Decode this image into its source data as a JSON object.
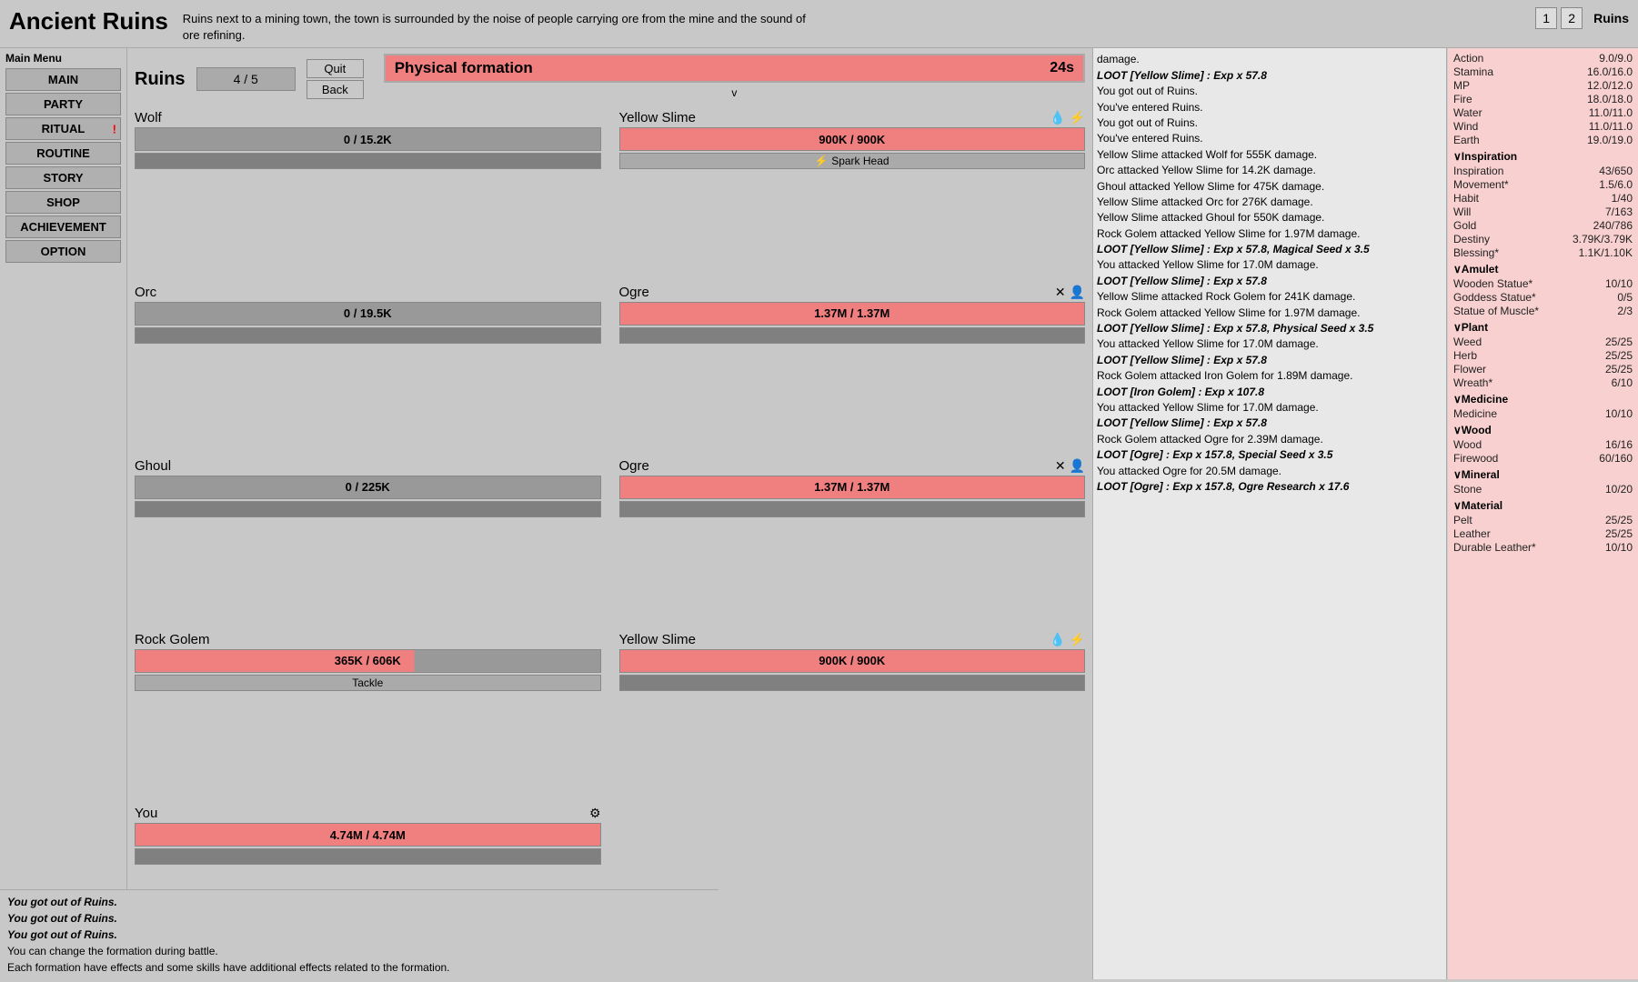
{
  "header": {
    "title": "Ancient Ruins",
    "description": "Ruins next to a mining town, the town is surrounded by the noise of people carrying ore from the mine and the sound of ore refining.",
    "page_nums": [
      "1",
      "2"
    ],
    "ruins_label": "Ruins"
  },
  "sidebar": {
    "menu_label": "Main Menu",
    "buttons": [
      {
        "label": "MAIN",
        "badge": ""
      },
      {
        "label": "PARTY",
        "badge": ""
      },
      {
        "label": "RITUAL",
        "badge": "!"
      },
      {
        "label": "ROUTINE",
        "badge": ""
      },
      {
        "label": "STORY",
        "badge": ""
      },
      {
        "label": "SHOP",
        "badge": ""
      },
      {
        "label": "ACHIEVEMENT",
        "badge": ""
      },
      {
        "label": "OPTION",
        "badge": ""
      }
    ]
  },
  "battle": {
    "title": "Ruins",
    "progress": "4 / 5",
    "quit_btn": "Quit",
    "back_btn": "Back",
    "formation": {
      "name": "Physical formation",
      "time": "24s",
      "arrow": "v"
    },
    "left_units": [
      {
        "name": "Wolf",
        "hp": "0 / 15.2K",
        "hp_color": "gray",
        "sub": "",
        "icons": []
      },
      {
        "name": "Orc",
        "hp": "0 / 19.5K",
        "hp_color": "gray",
        "sub": "",
        "icons": []
      },
      {
        "name": "Ghoul",
        "hp": "0 / 225K",
        "hp_color": "gray",
        "sub": "",
        "icons": []
      },
      {
        "name": "Rock Golem",
        "hp": "365K / 606K",
        "hp_color": "red",
        "sub": "Tackle",
        "icons": []
      },
      {
        "name": "You",
        "hp": "4.74M / 4.74M",
        "hp_color": "red",
        "sub": "",
        "icons": [
          "⚙"
        ]
      }
    ],
    "right_units": [
      {
        "name": "Yellow Slime",
        "hp": "900K / 900K",
        "hp_color": "red",
        "sub": "⚡ Spark Head",
        "icons": [
          "💧",
          "⚡"
        ]
      },
      {
        "name": "Ogre",
        "hp": "1.37M / 1.37M",
        "hp_color": "red",
        "sub": "",
        "icons": [
          "✕",
          "👤"
        ]
      },
      {
        "name": "Ogre",
        "hp": "1.37M / 1.37M",
        "hp_color": "red",
        "sub": "",
        "icons": [
          "✕",
          "👤"
        ]
      },
      {
        "name": "Yellow Slime",
        "hp": "900K / 900K",
        "hp_color": "red",
        "sub": "",
        "icons": [
          "💧",
          "⚡"
        ]
      }
    ]
  },
  "log": [
    {
      "text": "damage.",
      "bold": false
    },
    {
      "text": "LOOT [Yellow Slime] : Exp x 57.8",
      "bold": true
    },
    {
      "text": "You got out of Ruins.",
      "bold": false
    },
    {
      "text": "You've entered Ruins.",
      "bold": false
    },
    {
      "text": "You got out of Ruins.",
      "bold": false
    },
    {
      "text": "You've entered Ruins.",
      "bold": false
    },
    {
      "text": "Yellow Slime attacked Wolf for 555K damage.",
      "bold": false
    },
    {
      "text": "Orc attacked Yellow Slime for 14.2K damage.",
      "bold": false
    },
    {
      "text": "Ghoul attacked Yellow Slime for 475K damage.",
      "bold": false
    },
    {
      "text": "Yellow Slime attacked Orc for 276K damage.",
      "bold": false
    },
    {
      "text": "Yellow Slime attacked Ghoul for 550K damage.",
      "bold": false
    },
    {
      "text": "Rock Golem attacked Yellow Slime for 1.97M damage.",
      "bold": false
    },
    {
      "text": "LOOT [Yellow Slime] : Exp x 57.8, Magical Seed x 3.5",
      "bold": true
    },
    {
      "text": "You attacked Yellow Slime for 17.0M damage.",
      "bold": false
    },
    {
      "text": "LOOT [Yellow Slime] : Exp x 57.8",
      "bold": true
    },
    {
      "text": "Yellow Slime attacked Rock Golem for 241K damage.",
      "bold": false
    },
    {
      "text": "Rock Golem attacked Yellow Slime for 1.97M damage.",
      "bold": false
    },
    {
      "text": "LOOT [Yellow Slime] : Exp x 57.8, Physical Seed x 3.5",
      "bold": true
    },
    {
      "text": "You attacked Yellow Slime for 17.0M damage.",
      "bold": false
    },
    {
      "text": "LOOT [Yellow Slime] : Exp x 57.8",
      "bold": true
    },
    {
      "text": "Rock Golem attacked Iron Golem for 1.89M damage.",
      "bold": false
    },
    {
      "text": "LOOT [Iron Golem] : Exp x 107.8",
      "bold": true
    },
    {
      "text": "You attacked Yellow Slime for 17.0M damage.",
      "bold": false
    },
    {
      "text": "LOOT [Yellow Slime] : Exp x 57.8",
      "bold": true
    },
    {
      "text": "Rock Golem attacked Ogre for 2.39M damage.",
      "bold": false
    },
    {
      "text": "LOOT [Ogre] : Exp x 157.8, Special Seed x 3.5",
      "bold": true
    },
    {
      "text": "You attacked Ogre for 20.5M damage.",
      "bold": false
    },
    {
      "text": "LOOT [Ogre] : Exp x 157.8, Ogre Research x 17.6",
      "bold": true
    }
  ],
  "right_panel": {
    "stats": [
      {
        "name": "Action",
        "val": "9.0/9.0"
      },
      {
        "name": "Stamina",
        "val": "16.0/16.0"
      },
      {
        "name": "MP",
        "val": "12.0/12.0"
      },
      {
        "name": "Fire",
        "val": "18.0/18.0"
      },
      {
        "name": "Water",
        "val": "11.0/11.0"
      },
      {
        "name": "Wind",
        "val": "11.0/11.0"
      },
      {
        "name": "Earth",
        "val": "19.0/19.0"
      }
    ],
    "sections": [
      {
        "header": "∨Inspiration",
        "items": [
          {
            "name": "Inspiration",
            "val": "43/650"
          },
          {
            "name": "Movement*",
            "val": "1.5/6.0"
          },
          {
            "name": "Habit",
            "val": "1/40"
          },
          {
            "name": "Will",
            "val": "7/163"
          },
          {
            "name": "Gold",
            "val": "240/786"
          },
          {
            "name": "Destiny",
            "val": "3.79K/3.79K"
          },
          {
            "name": "Blessing*",
            "val": "1.1K/1.10K"
          }
        ]
      },
      {
        "header": "∨Amulet",
        "items": [
          {
            "name": "Wooden Statue*",
            "val": "10/10"
          },
          {
            "name": "Goddess Statue*",
            "val": "0/5"
          },
          {
            "name": "Statue of Muscle*",
            "val": "2/3"
          }
        ]
      },
      {
        "header": "∨Plant",
        "items": [
          {
            "name": "Weed",
            "val": "25/25"
          },
          {
            "name": "Herb",
            "val": "25/25"
          },
          {
            "name": "Flower",
            "val": "25/25"
          },
          {
            "name": "Wreath*",
            "val": "6/10"
          }
        ]
      },
      {
        "header": "∨Medicine",
        "items": [
          {
            "name": "Medicine",
            "val": "10/10"
          }
        ]
      },
      {
        "header": "∨Wood",
        "items": [
          {
            "name": "Wood",
            "val": "16/16"
          },
          {
            "name": "Firewood",
            "val": "60/160"
          }
        ]
      },
      {
        "header": "∨Mineral",
        "items": [
          {
            "name": "Stone",
            "val": "10/20"
          }
        ]
      },
      {
        "header": "∨Material",
        "items": [
          {
            "name": "Pelt",
            "val": "25/25"
          },
          {
            "name": "Leather",
            "val": "25/25"
          },
          {
            "name": "Durable Leather*",
            "val": "10/10"
          }
        ]
      }
    ]
  },
  "bottom_log": {
    "lines": [
      "You got out of Ruins.",
      "You got out of Ruins.",
      "You got out of Ruins."
    ],
    "desc_lines": [
      "You can change the formation during battle.",
      "Each formation have effects and some skills have additional effects related to the formation."
    ]
  }
}
